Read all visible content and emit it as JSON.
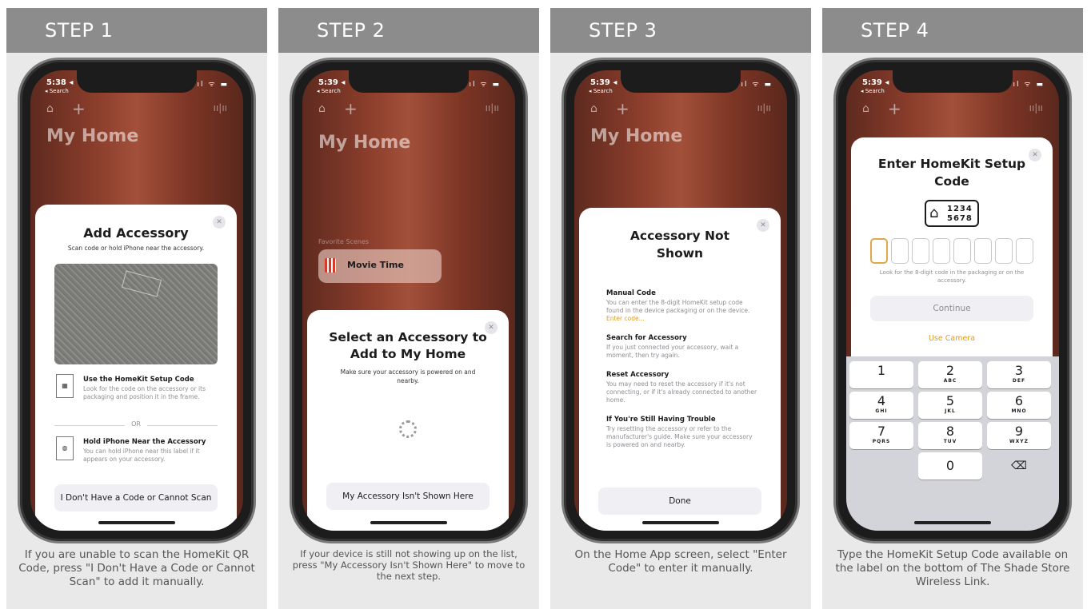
{
  "panels": [
    {
      "header": "STEP 1",
      "caption": "If you are unable to scan the HomeKit QR Code, press \"I Don't Have a Code or Cannot Scan\" to add it manually.",
      "status_time": "5:38 ◂",
      "status_back": "◂ Search",
      "home_title": "My Home",
      "sheet": {
        "title": "Add Accessory",
        "subtitle": "Scan code or hold iPhone near the accessory.",
        "option1_title": "Use the HomeKit Setup Code",
        "option1_desc": "Look for the code on the accessory or its packaging and position it in the frame.",
        "or": "OR",
        "option2_title": "Hold iPhone Near the Accessory",
        "option2_desc": "You can hold iPhone near this label if it appears on your accessory.",
        "button": "I Don't Have a Code or Cannot Scan"
      }
    },
    {
      "header": "STEP 2",
      "caption": "If your device is still not showing up on the list, press \"My Accessory Isn't Shown Here\" to move to the next step.",
      "status_time": "5:39 ◂",
      "status_back": "◂ Search",
      "home_title": "My Home",
      "favorite_label": "Favorite Scenes",
      "scene": "Movie Time",
      "sheet": {
        "title": "Select an Accessory to Add to My Home",
        "subtitle": "Make sure your accessory is powered on and nearby.",
        "button": "My Accessory Isn't Shown Here"
      }
    },
    {
      "header": "STEP 3",
      "caption": "On the Home App screen, select \"Enter Code\" to enter it manually.",
      "status_time": "5:39 ◂",
      "status_back": "◂ Search",
      "home_title": "My Home",
      "sheet": {
        "title": "Accessory Not Shown",
        "s1_title": "Manual Code",
        "s1_desc": "You can enter the 8-digit HomeKit setup code found in the device packaging or on the device.",
        "s1_link": "Enter code...",
        "s2_title": "Search for Accessory",
        "s2_desc": "If you just connected your accessory, wait a moment, then try again.",
        "s3_title": "Reset Accessory",
        "s3_desc": "You may need to reset the accessory if it's not connecting, or if it's already connected to another home.",
        "s4_title": "If You're Still Having Trouble",
        "s4_desc": "Try resetting the accessory or refer to the manufacturer's guide. Make sure your accessory is powered on and nearby.",
        "button": "Done"
      }
    },
    {
      "header": "STEP 4",
      "caption": "Type the HomeKit Setup Code available on the label on the bottom of The Shade Store Wireless Link.",
      "status_time": "5:39 ◂",
      "status_back": "◂ Search",
      "sheet": {
        "title": "Enter HomeKit Setup Code",
        "code_line1": "1234",
        "code_line2": "5678",
        "hint": "Look for the 8-digit code in the packaging or on the accessory.",
        "continue": "Continue",
        "use_camera": "Use Camera"
      },
      "keypad": [
        {
          "num": "1",
          "letters": ""
        },
        {
          "num": "2",
          "letters": "ABC"
        },
        {
          "num": "3",
          "letters": "DEF"
        },
        {
          "num": "4",
          "letters": "GHI"
        },
        {
          "num": "5",
          "letters": "JKL"
        },
        {
          "num": "6",
          "letters": "MNO"
        },
        {
          "num": "7",
          "letters": "PQRS"
        },
        {
          "num": "8",
          "letters": "TUV"
        },
        {
          "num": "9",
          "letters": "WXYZ"
        },
        {
          "num": "0",
          "letters": ""
        }
      ]
    }
  ],
  "icons": {
    "close": "✕",
    "home": "⌂",
    "plus": "+",
    "voice": "ıı|ıı",
    "delete": "⌫",
    "signal": "ıl ᯤ ▬"
  },
  "colors": {
    "header_bg": "#8c8c8c",
    "panel_bg": "#e9e9e9",
    "link": "#e09b1c"
  }
}
